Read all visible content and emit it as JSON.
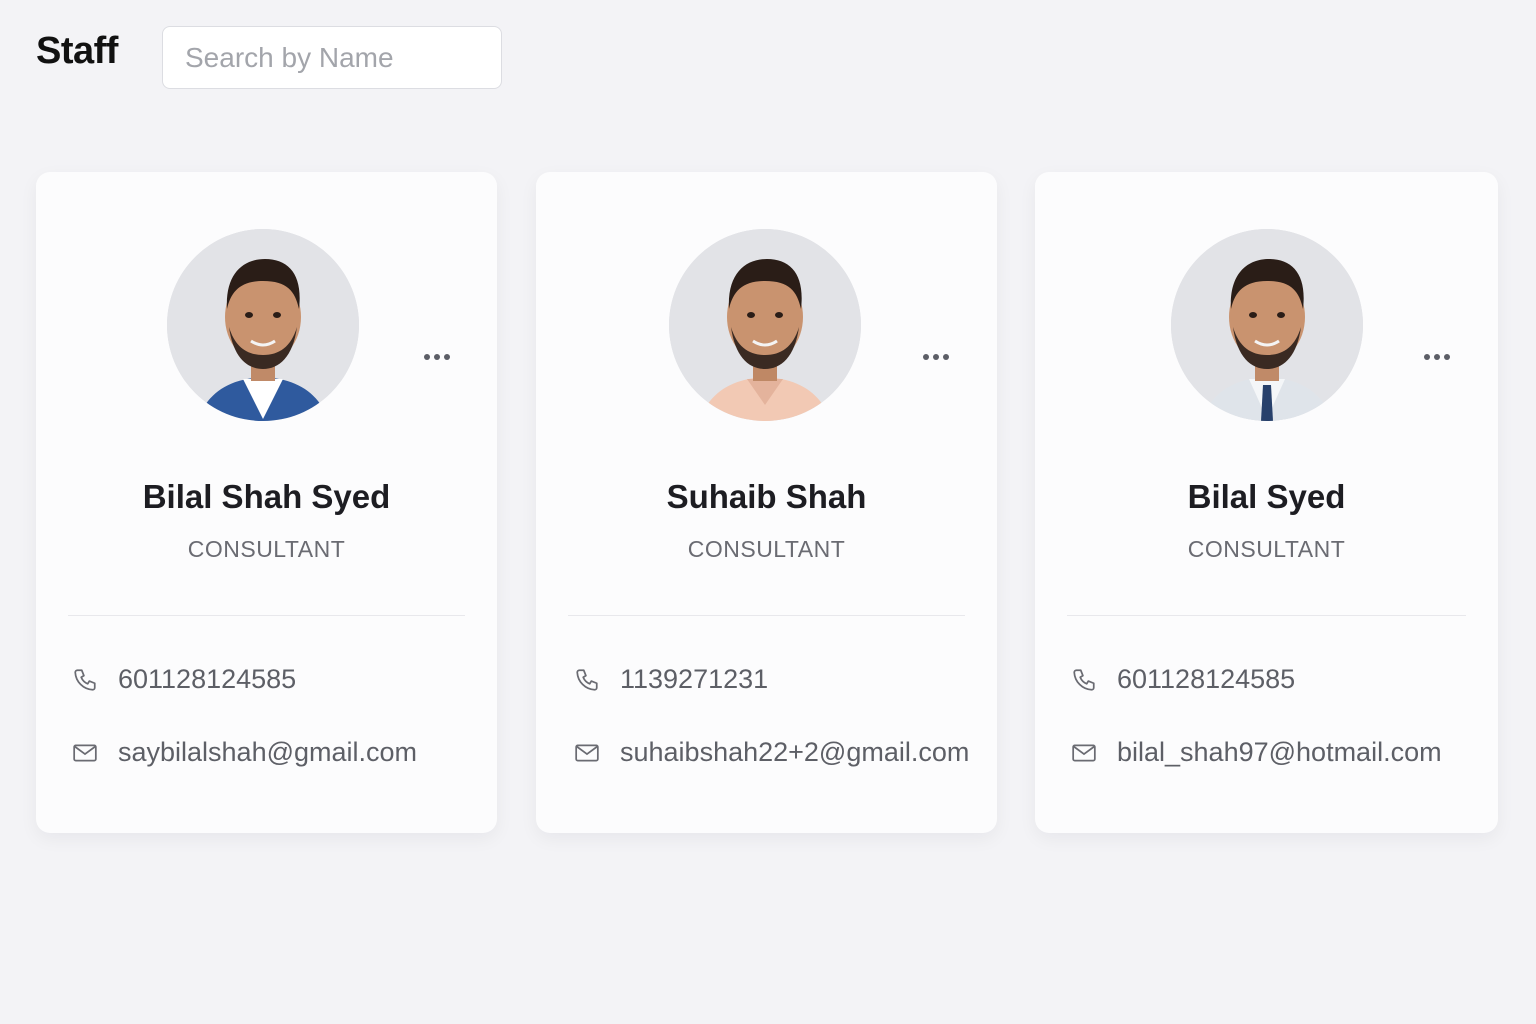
{
  "header": {
    "title": "Staff",
    "search_placeholder": "Search by Name",
    "search_value": ""
  },
  "staff": [
    {
      "name": "Bilal Shah Syed",
      "role": "CONSULTANT",
      "phone": "601128124585",
      "email": "saybilalshah@gmail.com",
      "shirt_color": "#ffffff",
      "jacket_color": "#2f5a9e"
    },
    {
      "name": "Suhaib Shah",
      "role": "CONSULTANT",
      "phone": "1139271231",
      "email": "suhaibshah22+2@gmail.com",
      "shirt_color": "#f2c9b4",
      "jacket_color": "#f2c9b4"
    },
    {
      "name": "Bilal Syed",
      "role": "CONSULTANT",
      "phone": "601128124585",
      "email": "bilal_shah97@hotmail.com",
      "shirt_color": "#eef2f6",
      "jacket_color": "#dfe4ea"
    }
  ],
  "icons": {
    "more": "more-horizontal-icon",
    "phone": "phone-icon",
    "email": "mail-icon"
  },
  "colors": {
    "background": "#f3f3f6",
    "card": "#fcfcfd",
    "text_primary": "#1d1d22",
    "text_secondary": "#6a6b72"
  }
}
